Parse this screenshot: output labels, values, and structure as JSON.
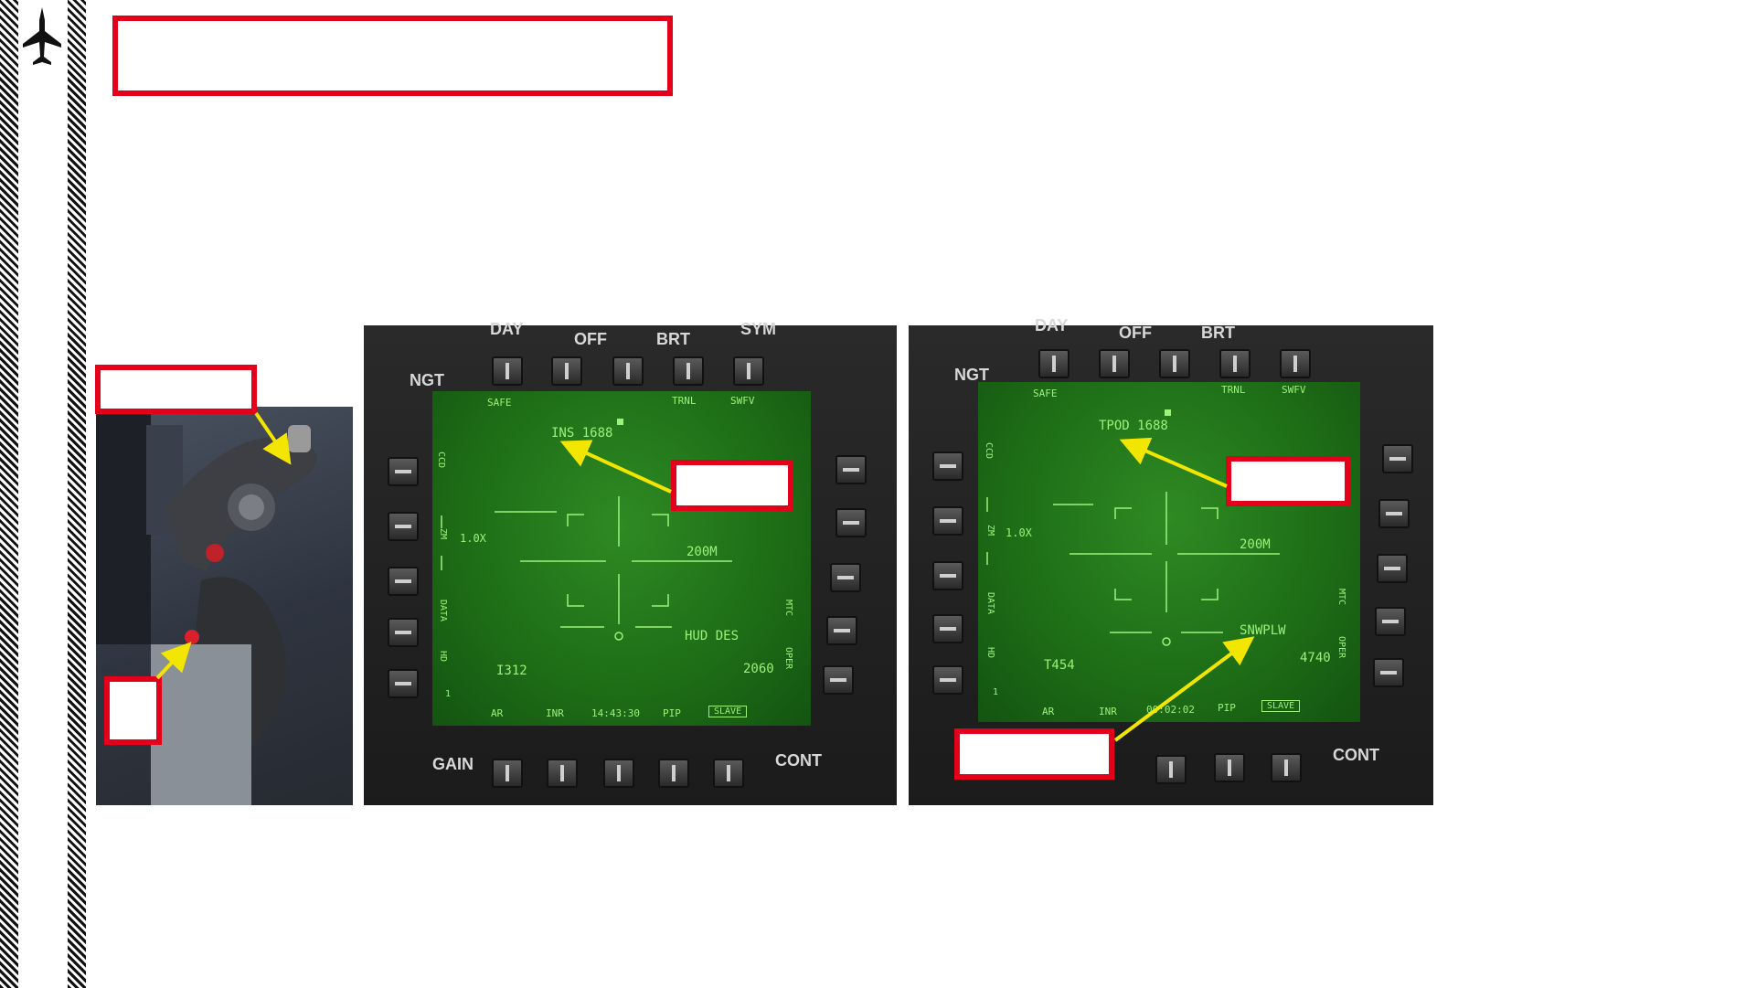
{
  "sidebar": {
    "icon": "jet-aircraft-icon"
  },
  "callouts": {
    "title_box": "",
    "throttle_box_top": "",
    "throttle_box_bottom": "",
    "mfd1_box": "",
    "mfd2_box_top": "",
    "mfd2_box_bottom": ""
  },
  "mfd1": {
    "bezel": {
      "day": "DAY",
      "off": "OFF",
      "brt": "BRT",
      "sym": "SYM",
      "ngt": "NGT",
      "gain": "GAIN",
      "cont": "CONT"
    },
    "screen": {
      "safe": "SAFE",
      "trnl": "TRNL",
      "swfv": "SWFV",
      "track": "INS  1688",
      "zoom": "1.0X",
      "range": "200M",
      "hud": "HUD DES",
      "t_code": "I312",
      "alt": "2060",
      "ar": "AR",
      "inr": "INR",
      "time": "14:43:30",
      "pip": "PIP",
      "slave": "SLAVE",
      "left_ccd": "CCD",
      "left_zm": "ZM",
      "left_data": "DATA",
      "left_hd": "HD",
      "one": "1",
      "right_mtc": "MTC",
      "right_oper": "OPER"
    }
  },
  "mfd2": {
    "bezel": {
      "day": "DAY",
      "off": "OFF",
      "brt": "BRT",
      "ngt": "NGT",
      "cont": "CONT"
    },
    "screen": {
      "safe": "SAFE",
      "trnl": "TRNL",
      "swfv": "SWFV",
      "track": "TPOD 1688",
      "zoom": "1.0X",
      "range": "200M",
      "snowplow": "SNWPLW",
      "t_code": "T454",
      "alt": "4740",
      "ar": "AR",
      "inr": "INR",
      "time": "00:02:02",
      "pip": "PIP",
      "slave": "SLAVE",
      "left_ccd": "CCD",
      "left_zm": "ZM",
      "left_data": "DATA",
      "left_hd": "HD",
      "one": "1",
      "right_mtc": "MTC",
      "right_oper": "OPER"
    }
  },
  "colors": {
    "callout_border": "#e3001b",
    "arrow": "#f2e600",
    "symbology": "#9cf27c"
  }
}
